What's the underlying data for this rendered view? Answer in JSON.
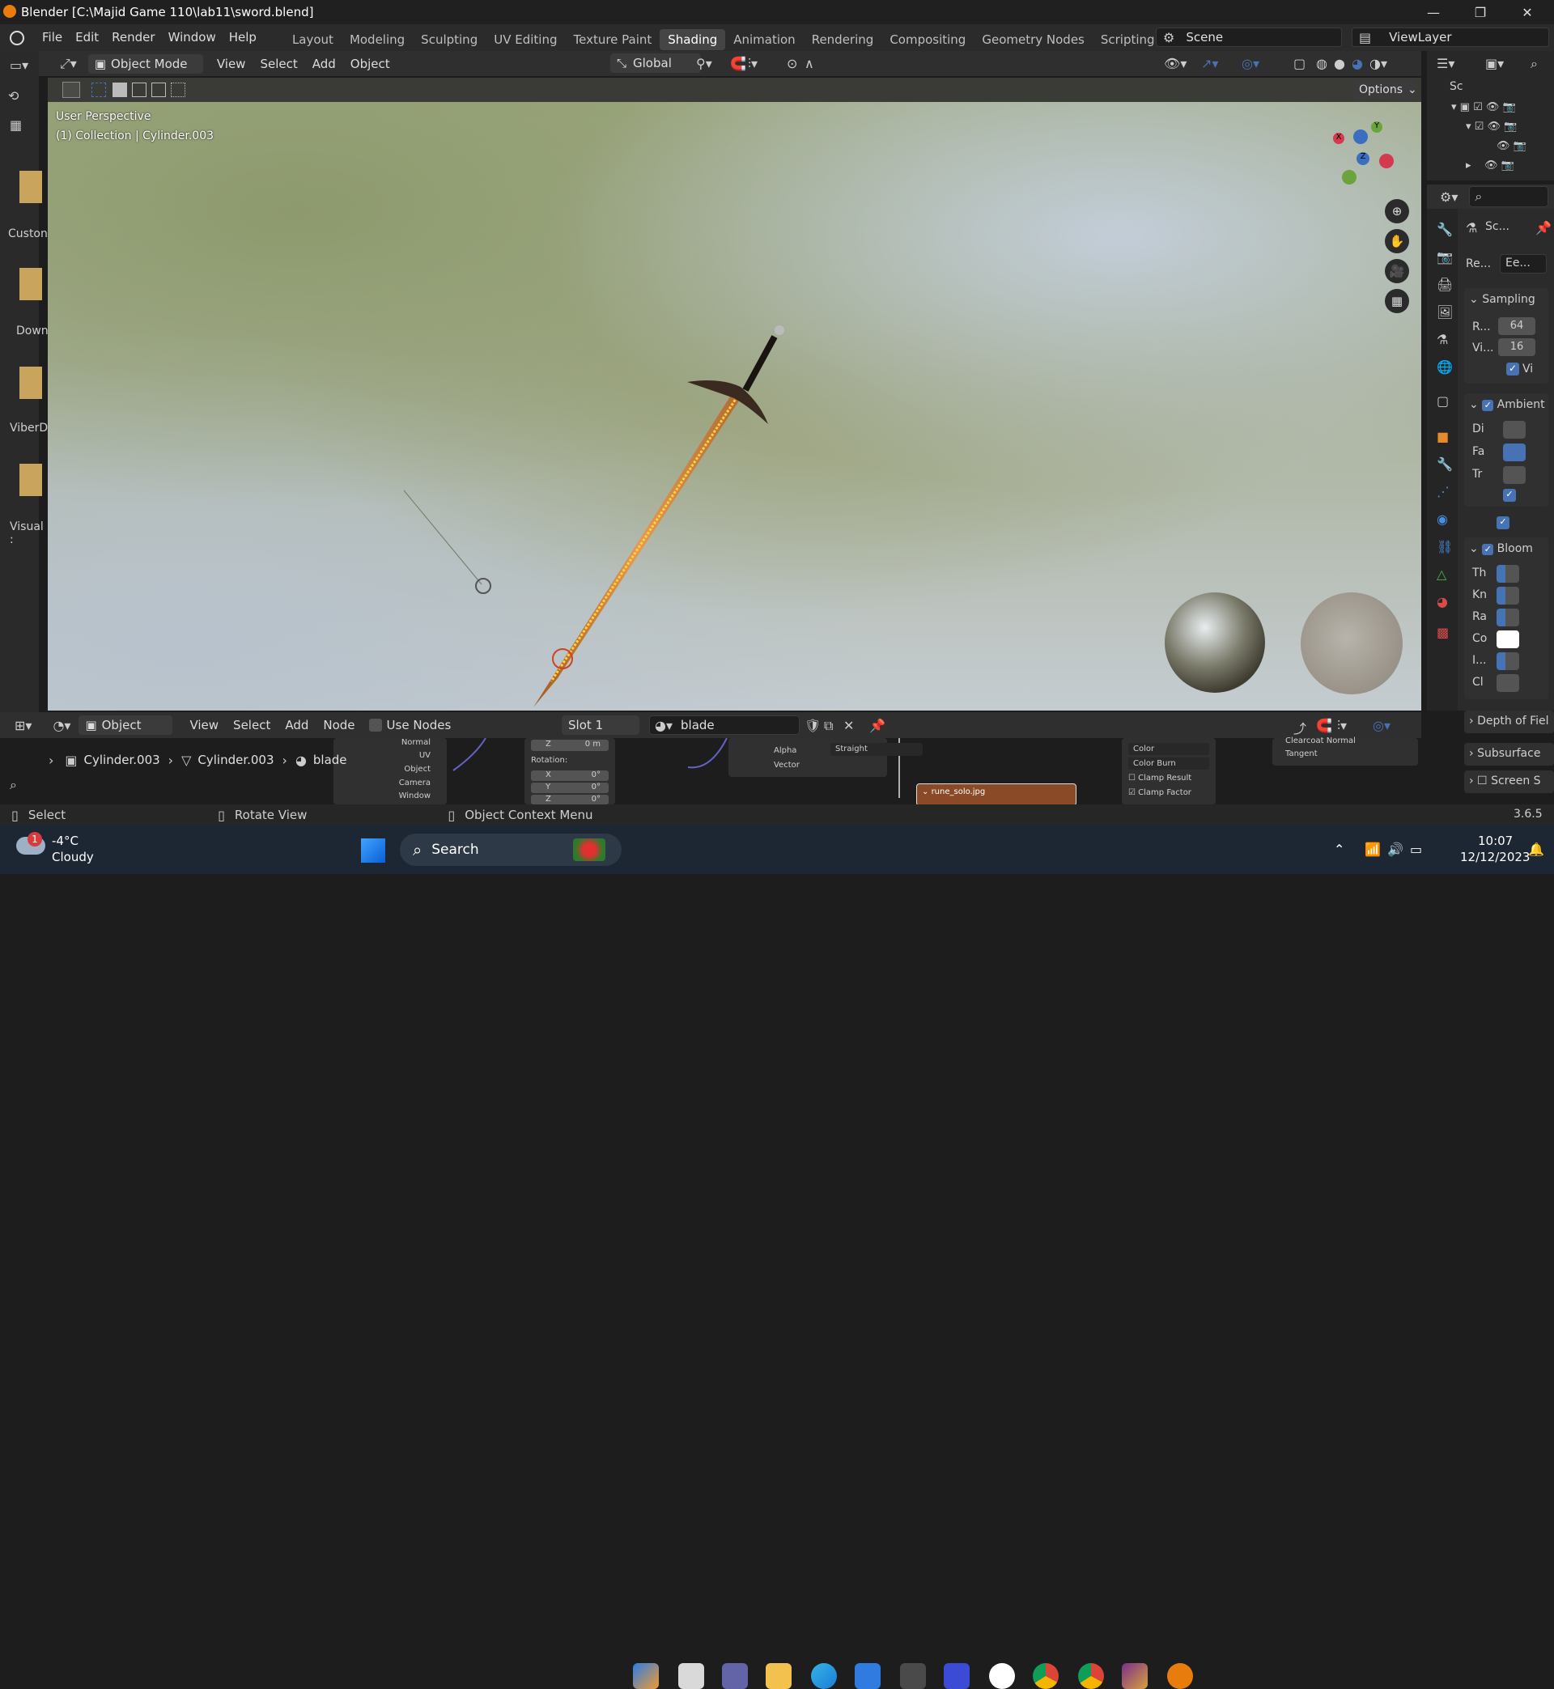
{
  "window": {
    "title": "Blender [C:\\Majid Game 110\\lab11\\sword.blend]"
  },
  "menu": {
    "file": "File",
    "edit": "Edit",
    "render": "Render",
    "window": "Window",
    "help": "Help"
  },
  "workspaces": [
    "Layout",
    "Modeling",
    "Sculpting",
    "UV Editing",
    "Texture Paint",
    "Shading",
    "Animation",
    "Rendering",
    "Compositing",
    "Geometry Nodes",
    "Scripting"
  ],
  "active_workspace": "Shading",
  "scene": {
    "name": "Scene",
    "view_layer": "ViewLayer"
  },
  "viewport_header": {
    "mode": "Object Mode",
    "view": "View",
    "select": "Select",
    "add": "Add",
    "object": "Object",
    "transform": "Global",
    "options": "Options"
  },
  "viewport": {
    "perspective": "User Perspective",
    "collection": "(1) Collection | Cylinder.003"
  },
  "file_browser": {
    "items": [
      "Custon",
      "Down",
      "ViberD",
      "Visual :"
    ]
  },
  "outliner": {
    "root": "Sc"
  },
  "properties": {
    "search": "",
    "scene_label": "Sc...",
    "render_engine_label": "Re...",
    "render_engine": "Ee...",
    "sampling": {
      "title": "Sampling",
      "render_label": "R...",
      "render_value": "64",
      "viewport_label": "Vi...",
      "viewport_value": "16",
      "denoise_label": "Vi"
    },
    "ambient": {
      "title": "Ambient",
      "rows": [
        "Di",
        "Fa",
        "Tr"
      ]
    },
    "bloom": {
      "title": "Bloom",
      "rows": [
        "Th",
        "Kn",
        "Ra",
        "Co",
        "I...",
        "Cl"
      ]
    },
    "collapsed": [
      "Depth of Fiel",
      "Subsurface",
      "Screen S"
    ]
  },
  "node_header": {
    "type": "Object",
    "view": "View",
    "select": "Select",
    "add": "Add",
    "node": "Node",
    "use_nodes": "Use Nodes",
    "slot": "Slot 1",
    "material": "blade"
  },
  "breadcrumbs": [
    "Cylinder.003",
    "Cylinder.003",
    "blade"
  ],
  "nodes": {
    "texcoord_outputs": [
      "Normal",
      "UV",
      "Object",
      "Camera",
      "Window"
    ],
    "mapping": {
      "z_label": "Z",
      "z_value": "0 m",
      "rotation": "Rotation:",
      "rx": "X",
      "rx_val": "0°",
      "ry": "Y",
      "ry_val": "0°",
      "rz": "Z",
      "rz_val": "0°"
    },
    "image": {
      "alpha": "Alpha",
      "alpha_mode": "Straight",
      "vector": "Vector"
    },
    "image_node_title": "rune_solo.jpg",
    "mix": {
      "type": "Color",
      "blend": "Color Burn",
      "clamp_result": "Clamp Result",
      "clamp_factor": "Clamp Factor"
    },
    "bsdf": {
      "clearcoat": "Clearcoat Normal",
      "tangent": "Tangent"
    }
  },
  "status": {
    "select": "Select",
    "rotate": "Rotate View",
    "context": "Object Context Menu",
    "version": "3.6.5"
  },
  "taskbar": {
    "temp": "-4°C",
    "weather": "Cloudy",
    "search": "Search",
    "time": "10:07",
    "date": "12/12/2023",
    "badge": "1"
  },
  "colors": {
    "accent": "#4772b3",
    "blade_glow": "#f5a623",
    "active_tab": "#454545"
  }
}
